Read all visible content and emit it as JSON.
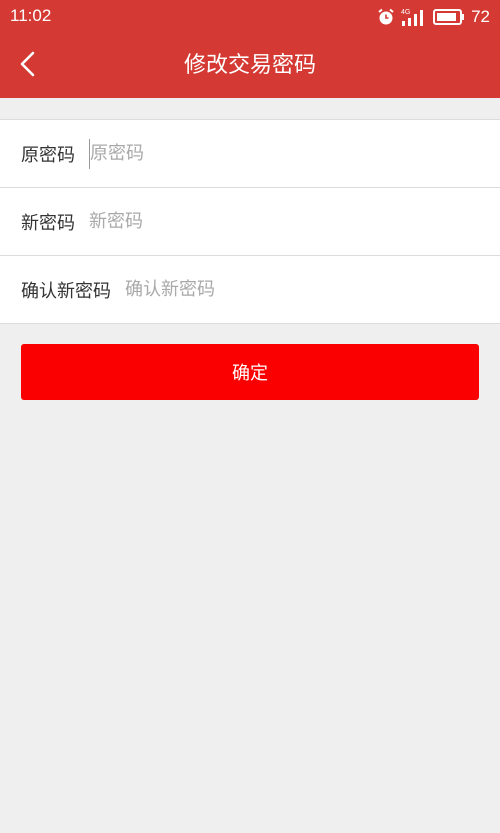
{
  "status_bar": {
    "time": "11:02",
    "network_label": "4G",
    "battery_level": "72",
    "icons": [
      "alarm-icon",
      "signal-icon",
      "battery-icon"
    ]
  },
  "header": {
    "title": "修改交易密码",
    "back_icon": "chevron-left-icon"
  },
  "form": {
    "old_password": {
      "label": "原密码",
      "placeholder": "原密码"
    },
    "new_password": {
      "label": "新密码",
      "placeholder": "新密码"
    },
    "confirm_password": {
      "label": "确认新密码",
      "placeholder": "确认新密码"
    }
  },
  "confirm_button": {
    "label": "确定"
  },
  "colors": {
    "header_bg": "#d43a33",
    "button_bg": "#fb0000",
    "page_bg": "#efefef"
  }
}
